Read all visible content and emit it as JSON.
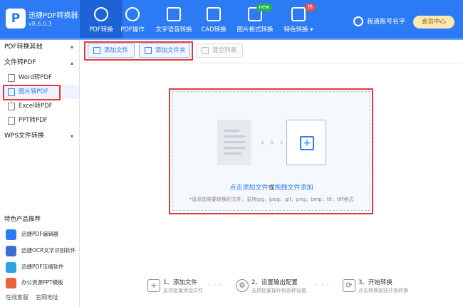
{
  "app": {
    "logo_glyph": "P",
    "name": "迅捷PDF转换器",
    "version": "v8.6.0.3"
  },
  "nav": [
    {
      "label": "PDF转换"
    },
    {
      "label": "PDF操作"
    },
    {
      "label": "文字语音转换"
    },
    {
      "label": "CAD转换"
    },
    {
      "label": "图片格式转换",
      "badge": "new"
    },
    {
      "label": "特色转换 ▾",
      "badge": "热"
    }
  ],
  "account": {
    "username": "我滴账号名字",
    "vip_label": "会员中心"
  },
  "sidebar": {
    "sections": [
      {
        "label": "PDF转换其他",
        "chevron": "▾"
      },
      {
        "label": "文件转PDF",
        "chevron": "▴"
      },
      {
        "label": "WPS文件转换",
        "chevron": "▾"
      }
    ],
    "items": [
      {
        "label": "Word转PDF"
      },
      {
        "label": "图片转PDF"
      },
      {
        "label": "Excel转PDF"
      },
      {
        "label": "PPT转PDF"
      }
    ],
    "products_title": "特色产品推荐",
    "products": [
      {
        "label": "迅捷PDF编辑器",
        "color": "#2d7bf4"
      },
      {
        "label": "迅捷OCR文字识别软件",
        "color": "#3b6fd1"
      },
      {
        "label": "迅捷PDF压缩软件",
        "color": "#2aa4e0"
      },
      {
        "label": "办公资源PPT模板",
        "color": "#e8643c"
      }
    ],
    "bottom_links": [
      "在线客服",
      "官网地址"
    ]
  },
  "toolbar": {
    "add_file": "添加文件",
    "add_folder": "添加文件夹",
    "clear_list": "清空列表"
  },
  "dropzone": {
    "click_add": "点击添加文件",
    "or": "或",
    "drag_add": "拖拽文件添加",
    "hint": "*请添加需要转换的文件，支持jpg，jpeg，gif，png，bmp，tif，tiff格式",
    "arrows": "› › ›",
    "plus": "+"
  },
  "steps": [
    {
      "title": "1、添加文件",
      "sub": "支持批量添加文件"
    },
    {
      "title": "2、设置输出配置",
      "sub": "支持批量操作和各种设置"
    },
    {
      "title": "3、开始转换",
      "sub": "点击转换按钮开始转换"
    }
  ],
  "step_arrow": "› › ›",
  "colors": {
    "brand": "#2d7bf4",
    "highlight": "#e23a3a"
  }
}
